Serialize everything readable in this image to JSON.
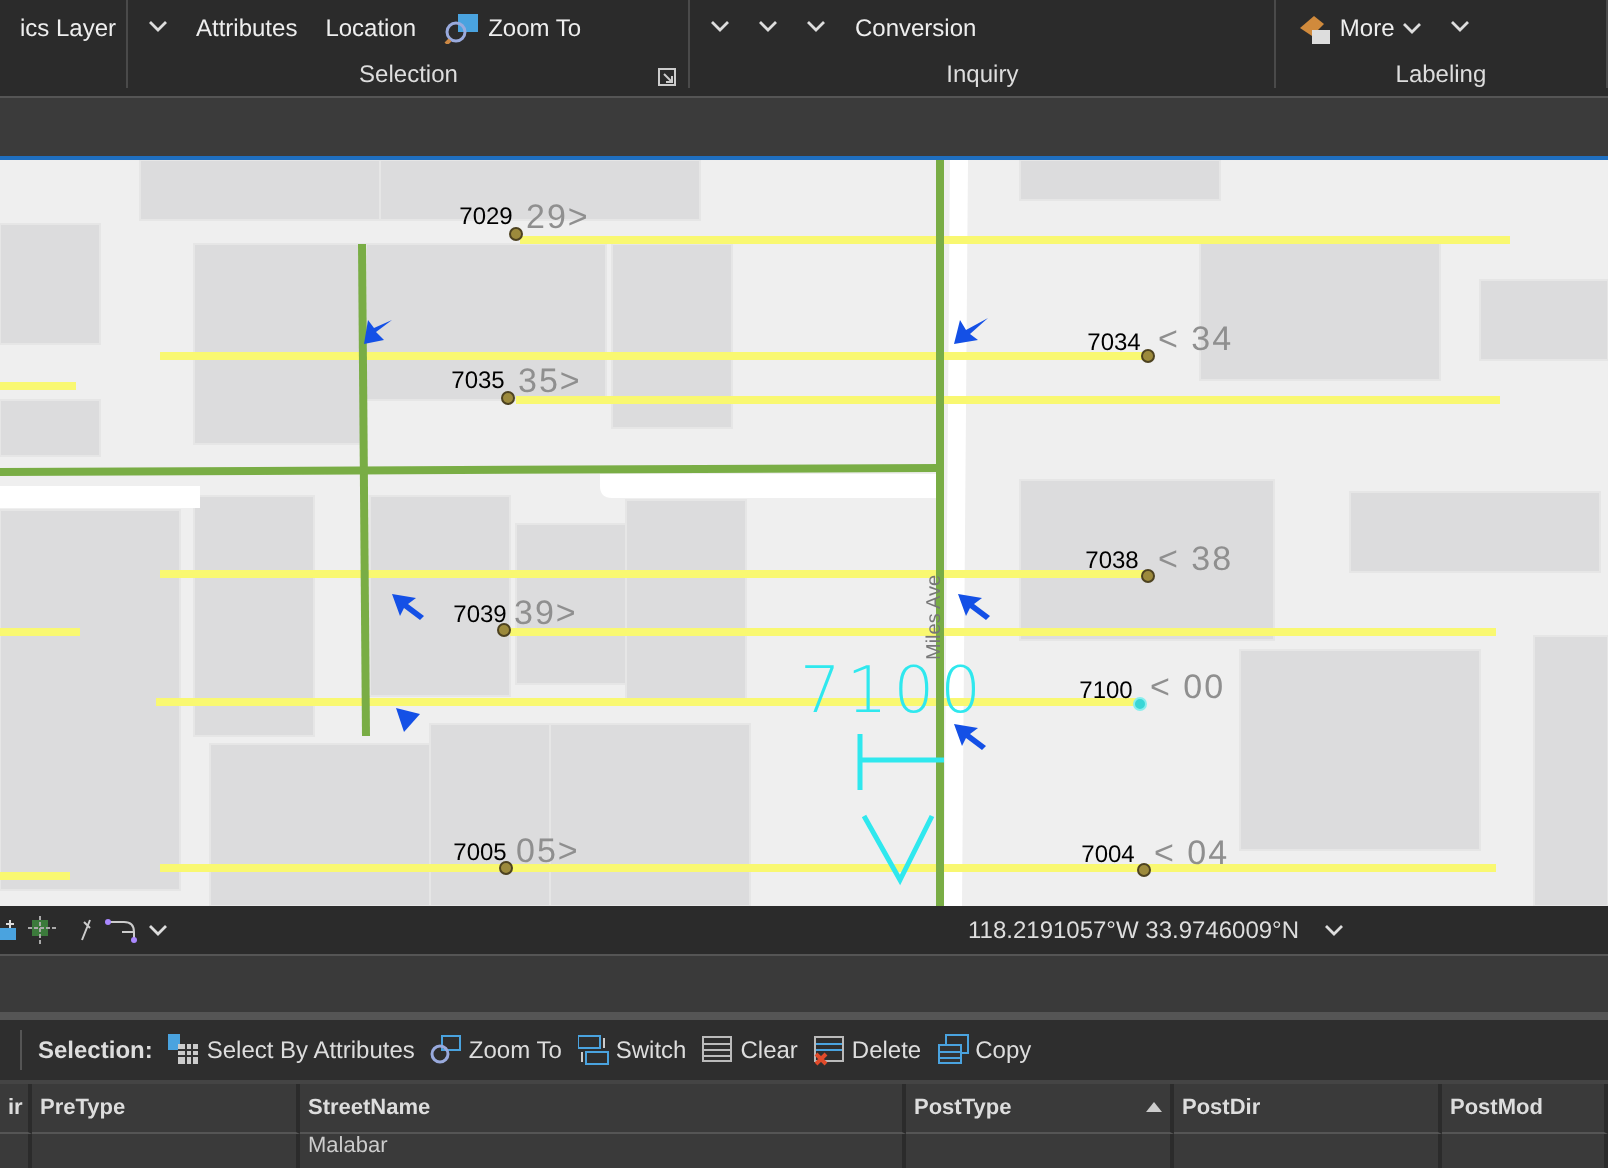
{
  "ribbon": {
    "groups": [
      {
        "items": [
          {
            "kind": "text",
            "text": "ics Layer"
          }
        ]
      },
      {
        "label": "Selection",
        "dialog_launcher": true,
        "items": [
          {
            "kind": "chevron"
          },
          {
            "kind": "text",
            "text": "Attributes"
          },
          {
            "kind": "text",
            "text": "Location"
          },
          {
            "kind": "zoom",
            "text": "Zoom To"
          }
        ]
      },
      {
        "label": "Inquiry",
        "items": [
          {
            "kind": "chevron"
          },
          {
            "kind": "chevron"
          },
          {
            "kind": "chevron"
          },
          {
            "kind": "text",
            "text": "Conversion"
          }
        ]
      },
      {
        "label": "Labeling",
        "items": [
          {
            "kind": "more",
            "text": "More"
          },
          {
            "kind": "chevron"
          }
        ]
      }
    ]
  },
  "map": {
    "street_label": "Miles Ave",
    "preview_label": "7100",
    "address_points": [
      {
        "label": "7029",
        "ghost_label": "29>",
        "selected": false
      },
      {
        "label": "7035",
        "ghost_label": "35>",
        "selected": false
      },
      {
        "label": "7039",
        "ghost_label": "39>",
        "selected": false
      },
      {
        "label": "7005",
        "ghost_label": "05>",
        "selected": false
      },
      {
        "label": "7034",
        "ghost_label": "< 34",
        "selected": false
      },
      {
        "label": "7038",
        "ghost_label": "< 38",
        "selected": false
      },
      {
        "label": "7100",
        "ghost_label": "< 00",
        "selected": true
      },
      {
        "label": "7004",
        "ghost_label": "< 04",
        "selected": false
      }
    ]
  },
  "status_bar": {
    "coordinates": "118.2191057°W 33.9746009°N"
  },
  "table": {
    "toolbar_label": "Selection:",
    "buttons": [
      {
        "kind": "select",
        "label": "Select By Attributes"
      },
      {
        "kind": "zoom",
        "label": "Zoom To"
      },
      {
        "kind": "switch",
        "label": "Switch"
      },
      {
        "kind": "clear",
        "label": "Clear"
      },
      {
        "kind": "delete",
        "label": "Delete"
      },
      {
        "kind": "copy",
        "label": "Copy"
      }
    ],
    "columns": [
      {
        "label": "ir",
        "sorted": false
      },
      {
        "label": "PreType",
        "sorted": false
      },
      {
        "label": "StreetName",
        "sorted": false
      },
      {
        "label": "PostType",
        "sorted": true
      },
      {
        "label": "PostDir",
        "sorted": false
      },
      {
        "label": "PostMod",
        "sorted": false
      }
    ],
    "rows": [
      [
        "",
        "",
        "Malabar",
        "",
        "",
        ""
      ]
    ]
  }
}
